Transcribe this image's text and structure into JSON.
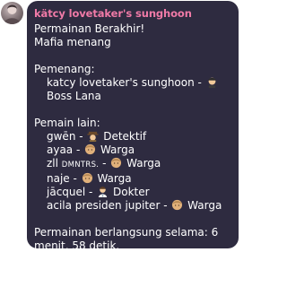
{
  "sender": {
    "name": "kätcy lovetaker's sunghoon"
  },
  "message": {
    "line1": "Permainan Berakhir!",
    "line2": "Mafia menang",
    "winners_heading": "Pemenang:",
    "winner_name": "katcy lovetaker's sunghoon - ",
    "winner_role": " Boss Lana",
    "players_heading": "Pemain lain:",
    "players": [
      {
        "name": "gwēn - ",
        "role": " Detektif",
        "icon": "detective-emoji"
      },
      {
        "name": "ayaa - ",
        "role": " Warga",
        "icon": "person-emoji"
      },
      {
        "name_prefix": "zll ",
        "name_smallcaps": "DMNTRS.",
        "name_suffix": " - ",
        "role": " Warga",
        "icon": "person-emoji"
      },
      {
        "name": "naje - ",
        "role": " Warga",
        "icon": "person-emoji"
      },
      {
        "name": "jācquel - ",
        "role": " Dokter",
        "icon": "doctor-emoji"
      },
      {
        "name": "acila presiden jupiter - ",
        "role": " Warga",
        "icon": "person-emoji"
      }
    ],
    "duration": "Permainan berlangsung selama: 6 menit, 58 detik."
  }
}
